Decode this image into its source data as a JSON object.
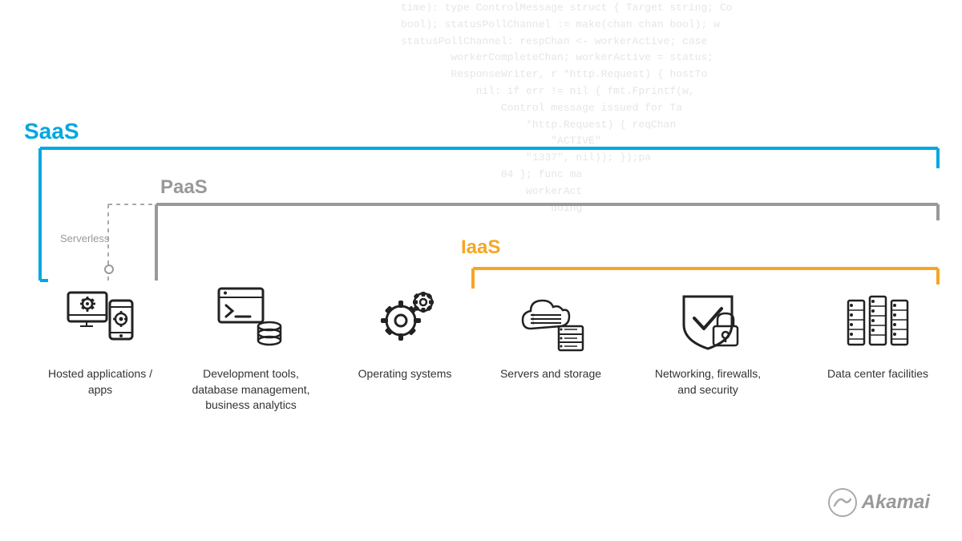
{
  "labels": {
    "saas": "SaaS",
    "paas": "PaaS",
    "iaas": "IaaS",
    "serverless": "Serverless"
  },
  "colors": {
    "saas": "#00A8E0",
    "paas": "#999999",
    "iaas": "#F5A623",
    "text": "#333333",
    "serverless_line": "#AAAAAA"
  },
  "items": [
    {
      "id": "hosted-apps",
      "label": "Hosted applications / apps",
      "icon": "hosted-apps-icon"
    },
    {
      "id": "dev-tools",
      "label": "Development tools, database management, business analytics",
      "icon": "dev-tools-icon"
    },
    {
      "id": "operating-systems",
      "label": "Operating systems",
      "icon": "operating-systems-icon"
    },
    {
      "id": "servers-storage",
      "label": "Servers and storage",
      "icon": "servers-storage-icon"
    },
    {
      "id": "networking",
      "label": "Networking, firewalls, and security",
      "icon": "networking-icon"
    },
    {
      "id": "data-center",
      "label": "Data center facilities",
      "icon": "data-center-icon"
    }
  ],
  "logo": {
    "text": "Akamai"
  }
}
